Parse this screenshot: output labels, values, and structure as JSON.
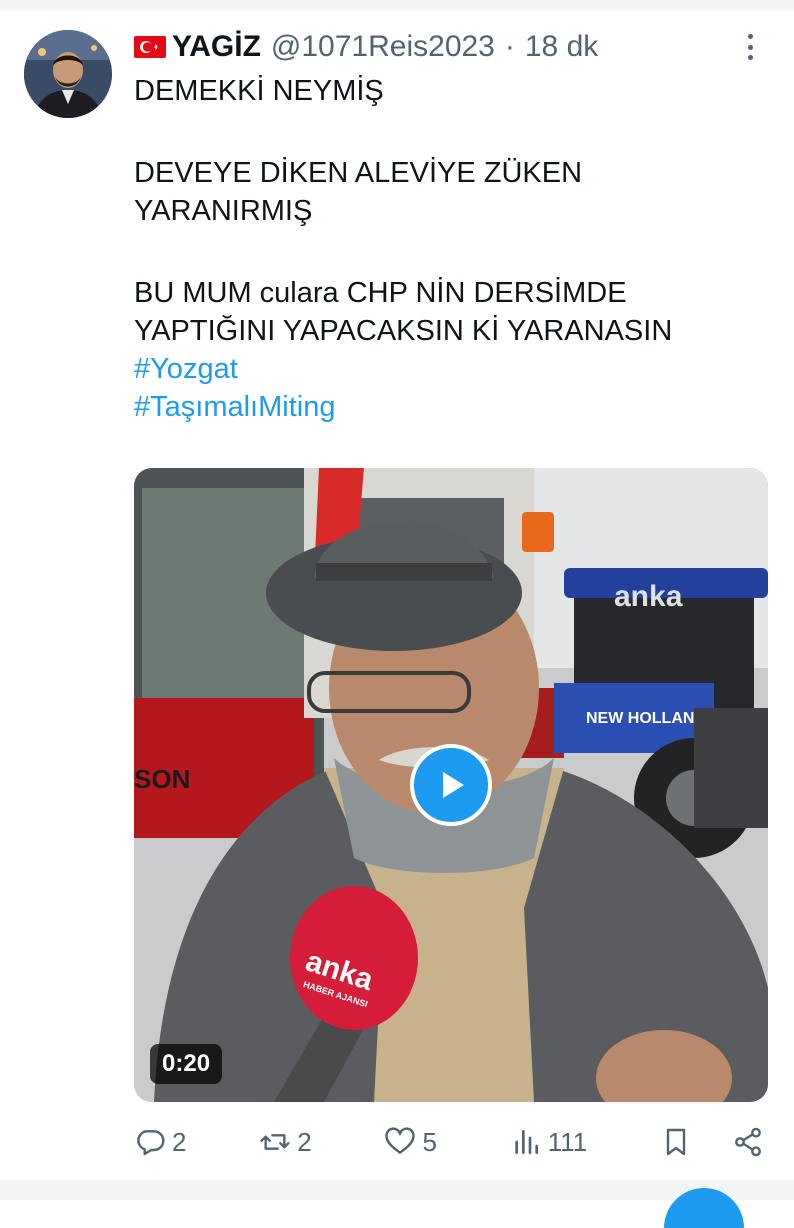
{
  "tweet": {
    "display_name": "YAGİZ",
    "handle": "@1071Reis2023",
    "separator": "·",
    "time": "18 dk",
    "lines": [
      "DEMEKKİ NEYMİŞ",
      "",
      "DEVEYE DİKEN ALEVİYE ZÜKEN",
      "YARANIRMIŞ",
      "",
      "BU MUM culara CHP NİN DERSİMDE",
      "YAPTIĞINI YAPACAKSIN Kİ YARANASIN"
    ],
    "hashtags": [
      "#Yozgat",
      "#TaşımalıMiting"
    ]
  },
  "media": {
    "duration": "0:20",
    "mic_brand": "anka",
    "mic_sub": "HABER AJANSI",
    "watermark": "anka",
    "tractor_brand": "NEW HOLLAND",
    "tractor_left_text": "SON"
  },
  "actions": {
    "replies": "2",
    "retweets": "2",
    "likes": "5",
    "views": "111"
  },
  "icons": {
    "flag": "turkey-flag-icon",
    "more": "more-options-icon",
    "play": "play-icon",
    "reply": "reply-icon",
    "retweet": "retweet-icon",
    "like": "heart-icon",
    "views": "analytics-icon",
    "bookmark": "bookmark-icon",
    "share": "share-icon"
  },
  "colors": {
    "accent": "#1d9bf0",
    "text": "#0f1419",
    "secondary": "#536471"
  }
}
